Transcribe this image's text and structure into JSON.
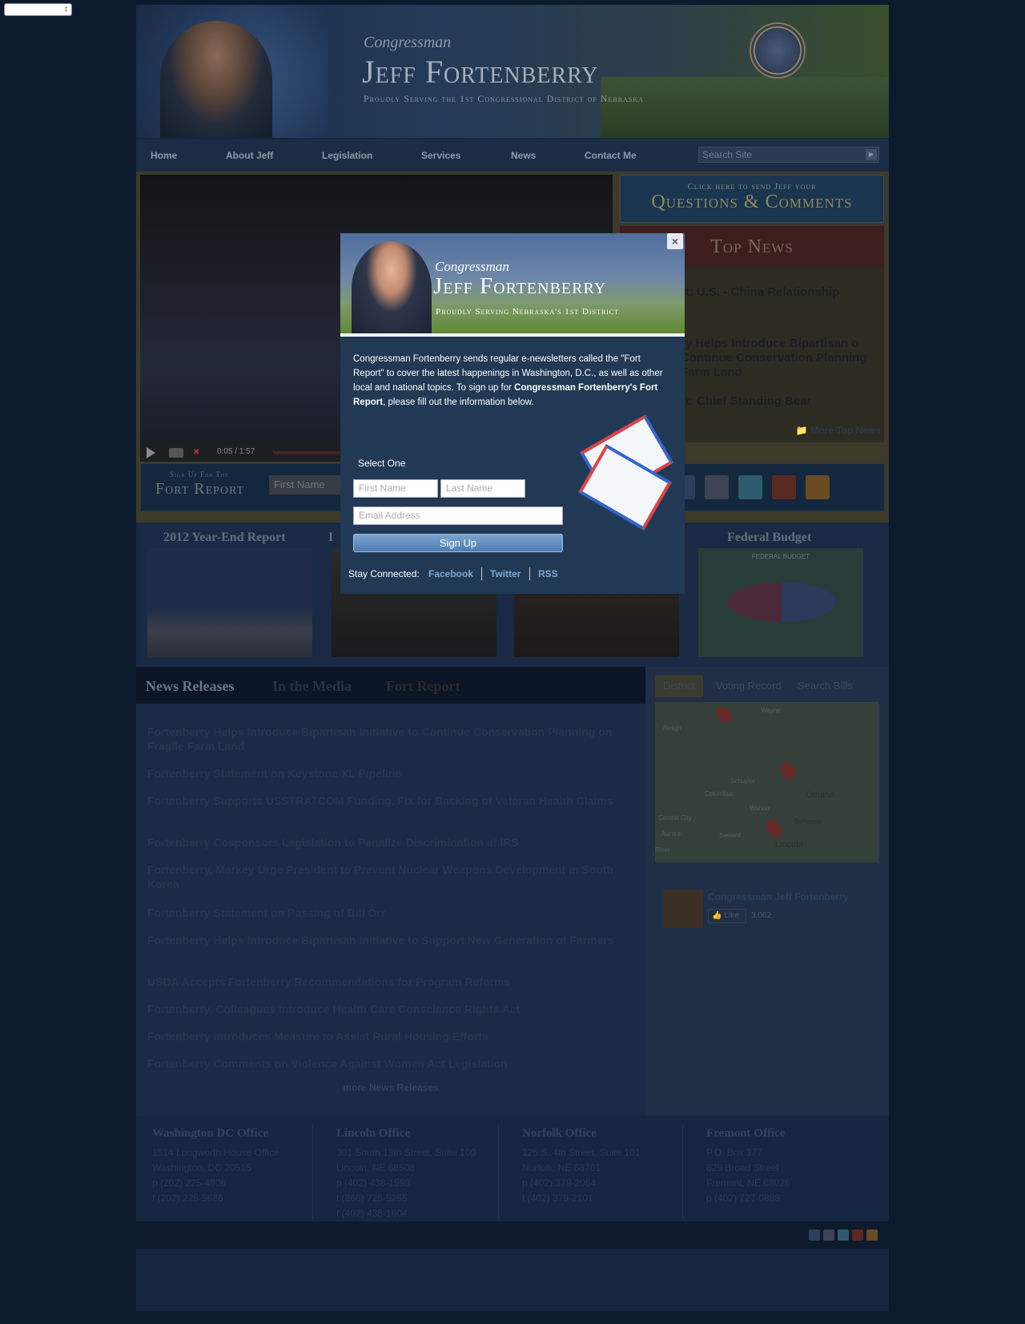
{
  "top_select": {
    "value": ""
  },
  "header": {
    "congressman": "Congressman",
    "name": "Jeff Fortenberry",
    "tagline": "Proudly Serving the 1st Congressional District of Nebraska"
  },
  "nav": {
    "items": [
      "Home",
      "About Jeff",
      "Legislation",
      "Services",
      "News",
      "Contact Me"
    ],
    "search_placeholder": "Search Site"
  },
  "video": {
    "time": "0:05 / 1:57"
  },
  "questions": {
    "line1": "Click here to send Jeff your",
    "line2": "Questions & Comments"
  },
  "top_news": {
    "heading": "Top News",
    "items": [
      "rt: U.S. - China Relationship",
      "ry Helps Introduce Bipartisan o Continue Conservation Planning Farm Land",
      "rt: Chief Standing Bear"
    ],
    "more": "More Top News"
  },
  "fort_report_strip": {
    "small": "Sign Up For The",
    "big": "Fort Report",
    "first_name_placeholder": "First Name"
  },
  "reports": {
    "titles": [
      "2012 Year-End Report",
      "I",
      "",
      "Federal Budget"
    ],
    "federal_budget_caption": "FEDERAL BUDGET"
  },
  "news": {
    "tabs": [
      "News Releases",
      "In the Media",
      "Fort Report"
    ],
    "items": [
      "Fortenberry Helps Introduce Bipartisan Initiative to Continue Conservation Planning on Fragile Farm Land",
      "Fortenberry Statement on Keystone XL Pipeline",
      "Fortenberry Supports USSTRATCOM Funding, Fix for Backlog of Veteran Health Claims",
      "Fortenberry Cosponsors Legislation to Penalize Discrimination at IRS",
      "Fortenberry, Markey Urge President to Prevent Nuclear Weapons Development in South Korea",
      "Fortenberry Statement on Passing of Bill Orr",
      "Fortenberry Helps Introduce Bipartisan Initiative to Support New Generation of Farmers",
      "USDA Accepts Fortenberry Recommendations for Program Reforms",
      "Fortenberry, Colleagues Introduce Health Care Conscience Rights Act",
      "Fortenberry Introduces Measure to Assist Rural Housing Efforts",
      "Fortenberry Comments on Violence Against Women Act Legislation"
    ],
    "more": "more News Releases"
  },
  "side": {
    "tabs": [
      "District",
      "Voting Record",
      "Search Bills"
    ],
    "map_labels": [
      "Wayne",
      "Neligh",
      "Schuyler",
      "Columbus",
      "Wahoo",
      "Omaha",
      "Central City",
      "Bellevue",
      "Aurora",
      "Seward",
      "Lincoln",
      "River"
    ],
    "facebook_name": "Congressman Jeff Fortenberry",
    "like_label": "Like",
    "like_count": "3,062"
  },
  "footer": {
    "offices": [
      {
        "title": "Washington DC Office",
        "lines": [
          "1514 Longworth House Office",
          "Washington, DC 20515",
          "p (202) 225-4806",
          "f  (202) 225-5686"
        ]
      },
      {
        "title": "Lincoln Office",
        "lines": [
          "301 South 13th Street, Suite 100",
          "Lincoln, NE 68508",
          "p (402) 438-1598",
          "t  (866) 725-5255",
          "f  (402) 438-1604"
        ]
      },
      {
        "title": "Norfolk Office",
        "lines": [
          "125 S. 4th Street, Suite 101",
          "Norfolk, NE 68701",
          "p (402) 379-2064",
          "f  (402) 379-2101"
        ]
      },
      {
        "title": "Fremont Office",
        "lines": [
          "P.O. Box 377",
          "629 Broad Street",
          "Fremont, NE 68026",
          "p (402) 727-0888"
        ]
      }
    ]
  },
  "modal": {
    "congressman": "Congressman",
    "name": "Jeff Fortenberry",
    "tagline": "Proudly Serving Nebraska's 1st District",
    "close": "×",
    "text_1": "Congressman Fortenberry sends regular e-newsletters called the \"Fort Report\" to cover the latest happenings in Washington, D.C., as well as other local and national topics. To sign up for ",
    "text_bold": "Congressman Fortenberry's Fort Report",
    "text_2": ", please fill out the information below.",
    "select_label": "Select One",
    "first_name_placeholder": "First Name",
    "last_name_placeholder": "Last Name",
    "email_placeholder": "Email Address",
    "signup": "Sign Up",
    "stay_connected": "Stay Connected:",
    "links": [
      "Facebook",
      "Twitter",
      "RSS"
    ]
  },
  "colors": {
    "overlay_bg": "#16263e",
    "modal_bg": "#213954",
    "link_blue": "#7aa8d8",
    "news_text": "#26374e"
  }
}
